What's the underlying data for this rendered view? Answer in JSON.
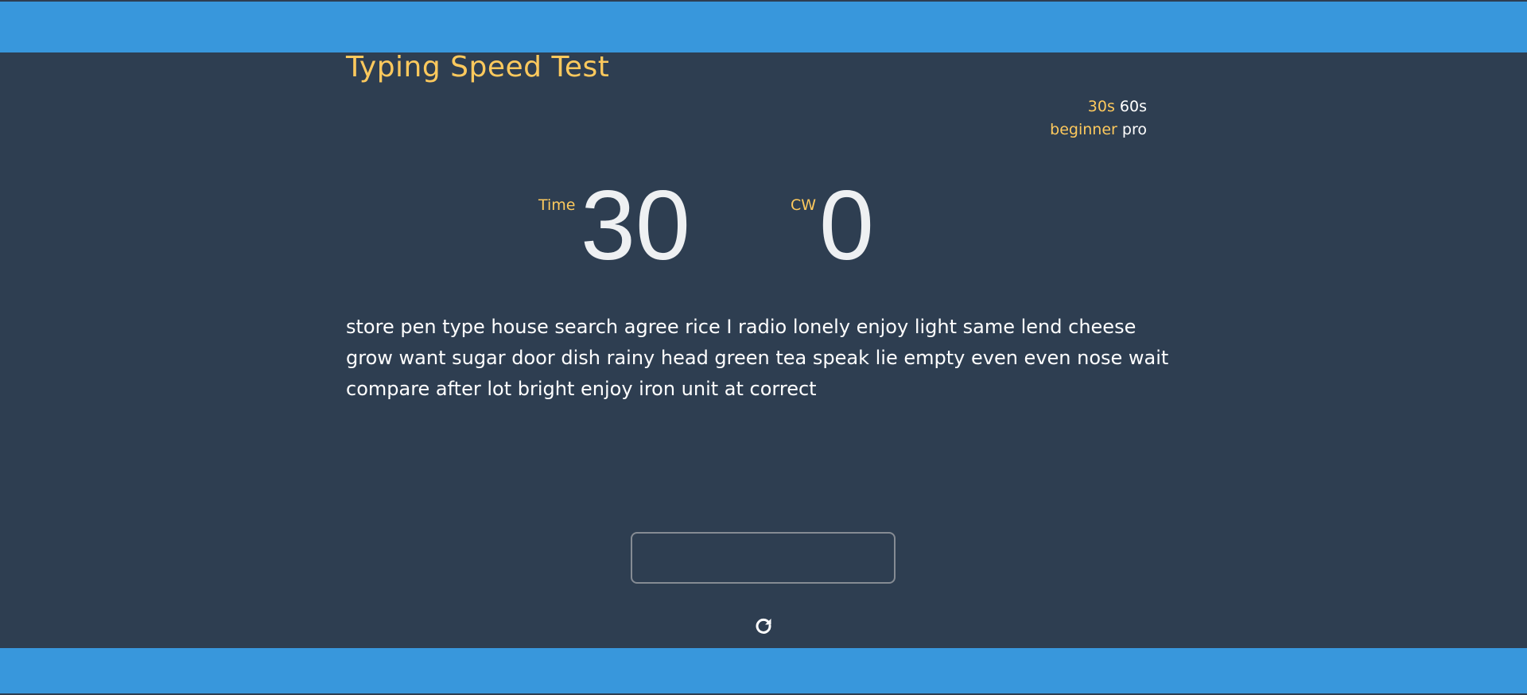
{
  "header": {
    "title": "Typing Speed Test"
  },
  "options": {
    "durations": [
      {
        "label": "30s",
        "active": true
      },
      {
        "label": "60s",
        "active": false
      }
    ],
    "levels": [
      {
        "label": "beginner",
        "active": true
      },
      {
        "label": "pro",
        "active": false
      }
    ]
  },
  "stats": {
    "time_label": "Time",
    "time_value": "30",
    "cw_label": "CW",
    "cw_value": "0"
  },
  "words": {
    "text": "store pen type house search agree rice I radio lonely enjoy light same lend cheese grow want sugar door dish rainy head green tea speak lie empty even even nose wait compare after lot bright enjoy iron unit at correct"
  },
  "input": {
    "value": "",
    "placeholder": ""
  },
  "icons": {
    "restart": "restart-icon"
  },
  "colors": {
    "background": "#2e3e51",
    "bar": "#3897dc",
    "accent": "#fdc95d",
    "text": "#ffffff"
  }
}
